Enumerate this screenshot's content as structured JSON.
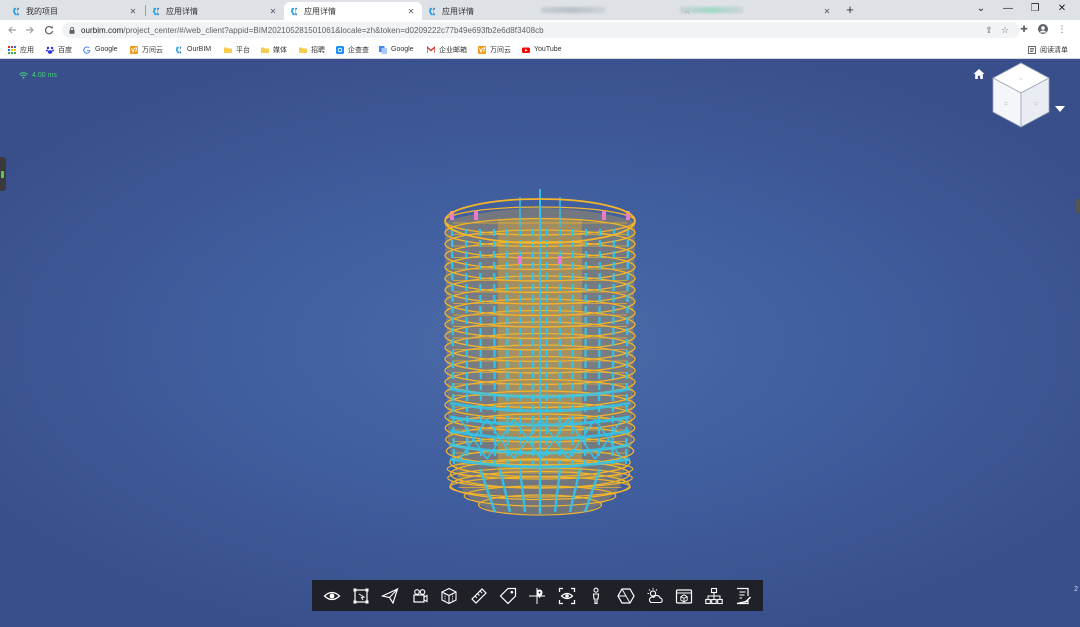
{
  "browser": {
    "tabs": [
      {
        "label": "我的项目",
        "active": false
      },
      {
        "label": "应用详情",
        "active": false
      },
      {
        "label": "应用详情",
        "active": true
      },
      {
        "label": "应用详情",
        "active": false
      }
    ],
    "close_glyph": "✕",
    "new_tab_glyph": "+",
    "window_controls": {
      "dropdown": "⌄",
      "minimize": "—",
      "restore": "❐",
      "close": "✕"
    },
    "url_host": "ourbim.com",
    "url_path": "/project_center/#/web_client?appid=BIM202105281501061&locale=zh&token=d0209222c77b49e693fb2e6d8f3408cb",
    "bookmarks": [
      {
        "label": "应用",
        "icon": "apps-grid-icon"
      },
      {
        "label": "百度",
        "icon": "baidu-icon"
      },
      {
        "label": "Google",
        "icon": "google-icon"
      },
      {
        "label": "万间云",
        "icon": "wanjian-icon"
      },
      {
        "label": "OurBIM",
        "icon": "ourbim-icon"
      },
      {
        "label": "平台",
        "icon": "folder-icon"
      },
      {
        "label": "媒体",
        "icon": "folder-icon"
      },
      {
        "label": "招聘",
        "icon": "folder-icon"
      },
      {
        "label": "企查查",
        "icon": "qichacha-icon"
      },
      {
        "label": "Google",
        "icon": "google-translate-icon"
      },
      {
        "label": "企业邮箱",
        "icon": "mail-icon"
      },
      {
        "label": "万间云",
        "icon": "wanjian-icon"
      },
      {
        "label": "YouTube",
        "icon": "youtube-icon"
      }
    ],
    "reading_list_label": "阅读清单"
  },
  "viewer": {
    "fps_text": "4.00 ms",
    "right_edge_number": "2",
    "colors": {
      "background": "#415f9f",
      "steel_yellow": "#f3b52a",
      "column_cyan": "#2ec8f0",
      "accent_pink": "#e87bd0",
      "toolbar_bg": "#1f2028"
    },
    "tools": [
      {
        "name": "visibility",
        "icon": "eye-icon"
      },
      {
        "name": "box-select",
        "icon": "select-box-icon"
      },
      {
        "name": "roam",
        "icon": "paper-plane-icon"
      },
      {
        "name": "camera-roam",
        "icon": "camera-icon"
      },
      {
        "name": "section-box",
        "icon": "cube-section-icon"
      },
      {
        "name": "measure",
        "icon": "ruler-icon"
      },
      {
        "name": "annotate",
        "icon": "tag-icon"
      },
      {
        "name": "location",
        "icon": "map-pin-icon"
      },
      {
        "name": "focus-view",
        "icon": "focus-eye-icon"
      },
      {
        "name": "person-view",
        "icon": "person-icon"
      },
      {
        "name": "render-mode",
        "icon": "hexagon-icon"
      },
      {
        "name": "weather",
        "icon": "sun-cloud-icon"
      },
      {
        "name": "model-browser",
        "icon": "model-box-icon"
      },
      {
        "name": "structure-tree",
        "icon": "tree-icon"
      },
      {
        "name": "properties",
        "icon": "document-edit-icon"
      }
    ]
  }
}
